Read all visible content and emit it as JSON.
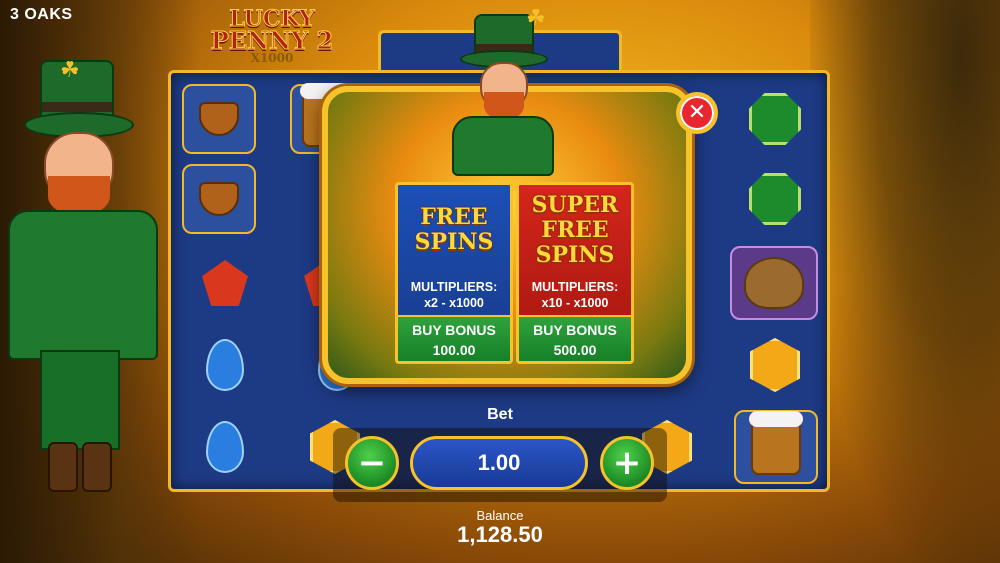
{
  "provider": "3 OAKS",
  "logo": {
    "line1": "LUCKY",
    "line2": "PENNY 2",
    "line3": "X1000"
  },
  "icons": {
    "close": "close-icon",
    "minus": "minus-icon",
    "plus": "plus-icon",
    "clover": "clover-icon"
  },
  "popup": {
    "close_glyph": "✕",
    "free": {
      "title": "FREE SPINS",
      "multipliers_label": "MULTIPLIERS:",
      "multipliers_range": "x2 - x1000",
      "buy_label": "BUY BONUS",
      "price": "100.00"
    },
    "super": {
      "title": "SUPER FREE SPINS",
      "multipliers_label": "MULTIPLIERS:",
      "multipliers_range": "x10 - x1000",
      "buy_label": "BUY BONUS",
      "price": "500.00"
    }
  },
  "bet": {
    "label": "Bet",
    "value": "1.00",
    "minus_glyph": "−",
    "plus_glyph": "+"
  },
  "balance": {
    "label": "Balance",
    "value": "1,128.50"
  },
  "colors": {
    "gold": "#f7c22a",
    "reel_blue": "#1d3a84",
    "buy_green": "#168028",
    "super_red": "#d4261c",
    "free_blue": "#1c4fb6"
  }
}
